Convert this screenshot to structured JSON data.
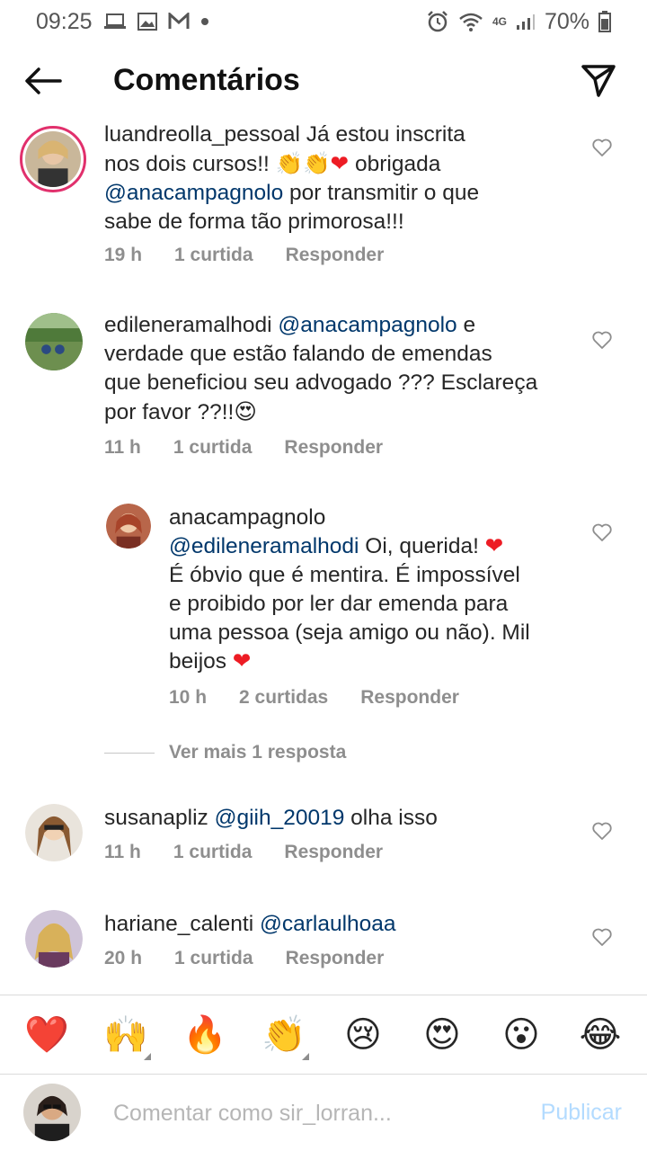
{
  "status": {
    "time": "09:25",
    "battery": "70%",
    "network": "4G",
    "icons_left": [
      "laptop-icon",
      "image-icon",
      "gmail-icon",
      "dot-icon"
    ],
    "icons_right": [
      "alarm-icon",
      "wifi-icon",
      "signal-icon",
      "battery-icon"
    ]
  },
  "header": {
    "title": "Comentários"
  },
  "comments": [
    {
      "user": "luandreolla_pessoal",
      "text_1": " Já estou inscrita",
      "text_2": "nos dois cursos!! ",
      "emojis": "👏👏",
      "heart": "❤",
      "text_3": " obrigada",
      "mention": "@anacampagnolo",
      "text_4": " por transmitir o que",
      "text_5": "sabe de forma tão primorosa!!!",
      "time": "19 h",
      "likes": "1 curtida",
      "reply": "Responder"
    },
    {
      "user": "edileneramalhodi",
      "mention": "@anacampagnolo",
      "text_1": " e",
      "text_2": "verdade que estão falando de emendas",
      "text_3": "que beneficiou seu advogado ??? Esclareça",
      "text_4": "por favor ??!!",
      "emoji": "😍",
      "time": "11 h",
      "likes": "1 curtida",
      "reply": "Responder"
    },
    {
      "user": "anacampagnolo",
      "mention": "@edileneramalhodi",
      "text_1": " Oi, querida! ",
      "heart": "❤",
      "text_2": "É óbvio que é mentira. É impossível",
      "text_3": "e proibido por ler dar emenda para",
      "text_4": "uma pessoa (seja amigo ou não). Mil",
      "text_5": "beijos ",
      "time": "10 h",
      "likes": "2 curtidas",
      "reply": "Responder"
    },
    {
      "user": "susanapliz",
      "mention": "@giih_20019",
      "text_1": " olha isso",
      "time": "11 h",
      "likes": "1 curtida",
      "reply": "Responder"
    },
    {
      "user": "hariane_calenti",
      "mention": "@carlaulhoaa",
      "time": "20 h",
      "likes": "1 curtida",
      "reply": "Responder"
    }
  ],
  "more_replies": "Ver mais 1 resposta",
  "reactions": [
    "❤️",
    "🙌",
    "🔥",
    "👏",
    "😢",
    "😍",
    "😮",
    "😂"
  ],
  "composer": {
    "placeholder": "Comentar como sir_lorran...",
    "publish": "Publicar"
  },
  "colors": {
    "mention": "#00376b",
    "meta": "#8e8e8e",
    "publish": "#b3dbff",
    "heart": "#ed1c24"
  }
}
